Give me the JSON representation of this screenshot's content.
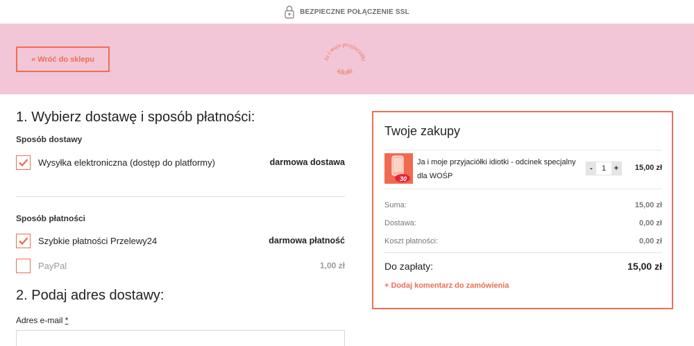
{
  "ssl": {
    "label": "BEZPIECZNE POŁĄCZENIE SSL",
    "icon": "lock-icon"
  },
  "header": {
    "back_label": "« Wróć do sklepu",
    "logo_top": "Ja i moje przyjaciółki",
    "logo_bottom": "idiotki",
    "banner_color": "#f2c6d6",
    "accent_color": "#ee6e52"
  },
  "step1": {
    "title": "1. Wybierz dostawę i sposób płatności:",
    "delivery_heading": "Sposób dostawy",
    "delivery_options": [
      {
        "label": "Wysyłka elektroniczna (dostęp do platformy)",
        "price": "darmowa dostawa",
        "checked": true
      }
    ],
    "payment_heading": "Sposób płatności",
    "payment_options": [
      {
        "label": "Szybkie płatności Przelewy24",
        "price": "darmowa płatność",
        "checked": true
      },
      {
        "label": "PayPal",
        "price": "1,00 zł",
        "checked": false
      }
    ]
  },
  "step2": {
    "title": "2. Podaj adres dostawy:",
    "email_label": "Adres e-mail",
    "required_mark": "*",
    "email_value": ""
  },
  "cart": {
    "title": "Twoje zakupy",
    "product": {
      "name": "Ja i moje przyjaciółki idiotki - odcinek specjalny dla WOŚP",
      "badge": "30",
      "quantity": "1",
      "minus": "-",
      "plus": "+",
      "price": "15,00 zł"
    },
    "summary": [
      {
        "label": "Suma:",
        "value": "15,00 zł"
      },
      {
        "label": "Dostawa:",
        "value": "0,00 zł"
      },
      {
        "label": "Koszt płatności:",
        "value": "0,00 zł"
      }
    ],
    "total_label": "Do zapłaty:",
    "total_value": "15,00 zł",
    "add_comment": "+ Dodaj komentarz do zamówienia"
  }
}
